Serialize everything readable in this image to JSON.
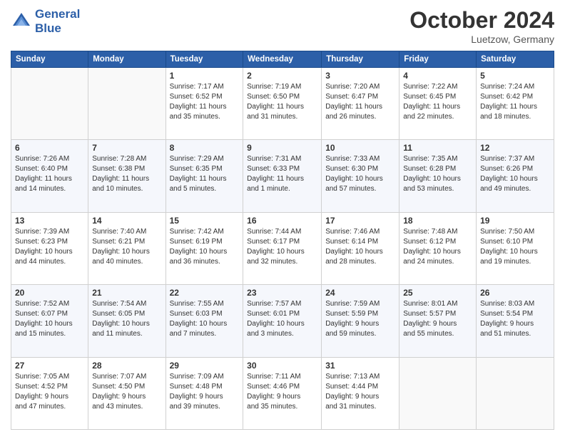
{
  "header": {
    "logo_line1": "General",
    "logo_line2": "Blue",
    "month": "October 2024",
    "location": "Luetzow, Germany"
  },
  "weekdays": [
    "Sunday",
    "Monday",
    "Tuesday",
    "Wednesday",
    "Thursday",
    "Friday",
    "Saturday"
  ],
  "rows": [
    [
      {
        "day": "",
        "info": ""
      },
      {
        "day": "",
        "info": ""
      },
      {
        "day": "1",
        "info": "Sunrise: 7:17 AM\nSunset: 6:52 PM\nDaylight: 11 hours\nand 35 minutes."
      },
      {
        "day": "2",
        "info": "Sunrise: 7:19 AM\nSunset: 6:50 PM\nDaylight: 11 hours\nand 31 minutes."
      },
      {
        "day": "3",
        "info": "Sunrise: 7:20 AM\nSunset: 6:47 PM\nDaylight: 11 hours\nand 26 minutes."
      },
      {
        "day": "4",
        "info": "Sunrise: 7:22 AM\nSunset: 6:45 PM\nDaylight: 11 hours\nand 22 minutes."
      },
      {
        "day": "5",
        "info": "Sunrise: 7:24 AM\nSunset: 6:42 PM\nDaylight: 11 hours\nand 18 minutes."
      }
    ],
    [
      {
        "day": "6",
        "info": "Sunrise: 7:26 AM\nSunset: 6:40 PM\nDaylight: 11 hours\nand 14 minutes."
      },
      {
        "day": "7",
        "info": "Sunrise: 7:28 AM\nSunset: 6:38 PM\nDaylight: 11 hours\nand 10 minutes."
      },
      {
        "day": "8",
        "info": "Sunrise: 7:29 AM\nSunset: 6:35 PM\nDaylight: 11 hours\nand 5 minutes."
      },
      {
        "day": "9",
        "info": "Sunrise: 7:31 AM\nSunset: 6:33 PM\nDaylight: 11 hours\nand 1 minute."
      },
      {
        "day": "10",
        "info": "Sunrise: 7:33 AM\nSunset: 6:30 PM\nDaylight: 10 hours\nand 57 minutes."
      },
      {
        "day": "11",
        "info": "Sunrise: 7:35 AM\nSunset: 6:28 PM\nDaylight: 10 hours\nand 53 minutes."
      },
      {
        "day": "12",
        "info": "Sunrise: 7:37 AM\nSunset: 6:26 PM\nDaylight: 10 hours\nand 49 minutes."
      }
    ],
    [
      {
        "day": "13",
        "info": "Sunrise: 7:39 AM\nSunset: 6:23 PM\nDaylight: 10 hours\nand 44 minutes."
      },
      {
        "day": "14",
        "info": "Sunrise: 7:40 AM\nSunset: 6:21 PM\nDaylight: 10 hours\nand 40 minutes."
      },
      {
        "day": "15",
        "info": "Sunrise: 7:42 AM\nSunset: 6:19 PM\nDaylight: 10 hours\nand 36 minutes."
      },
      {
        "day": "16",
        "info": "Sunrise: 7:44 AM\nSunset: 6:17 PM\nDaylight: 10 hours\nand 32 minutes."
      },
      {
        "day": "17",
        "info": "Sunrise: 7:46 AM\nSunset: 6:14 PM\nDaylight: 10 hours\nand 28 minutes."
      },
      {
        "day": "18",
        "info": "Sunrise: 7:48 AM\nSunset: 6:12 PM\nDaylight: 10 hours\nand 24 minutes."
      },
      {
        "day": "19",
        "info": "Sunrise: 7:50 AM\nSunset: 6:10 PM\nDaylight: 10 hours\nand 19 minutes."
      }
    ],
    [
      {
        "day": "20",
        "info": "Sunrise: 7:52 AM\nSunset: 6:07 PM\nDaylight: 10 hours\nand 15 minutes."
      },
      {
        "day": "21",
        "info": "Sunrise: 7:54 AM\nSunset: 6:05 PM\nDaylight: 10 hours\nand 11 minutes."
      },
      {
        "day": "22",
        "info": "Sunrise: 7:55 AM\nSunset: 6:03 PM\nDaylight: 10 hours\nand 7 minutes."
      },
      {
        "day": "23",
        "info": "Sunrise: 7:57 AM\nSunset: 6:01 PM\nDaylight: 10 hours\nand 3 minutes."
      },
      {
        "day": "24",
        "info": "Sunrise: 7:59 AM\nSunset: 5:59 PM\nDaylight: 9 hours\nand 59 minutes."
      },
      {
        "day": "25",
        "info": "Sunrise: 8:01 AM\nSunset: 5:57 PM\nDaylight: 9 hours\nand 55 minutes."
      },
      {
        "day": "26",
        "info": "Sunrise: 8:03 AM\nSunset: 5:54 PM\nDaylight: 9 hours\nand 51 minutes."
      }
    ],
    [
      {
        "day": "27",
        "info": "Sunrise: 7:05 AM\nSunset: 4:52 PM\nDaylight: 9 hours\nand 47 minutes."
      },
      {
        "day": "28",
        "info": "Sunrise: 7:07 AM\nSunset: 4:50 PM\nDaylight: 9 hours\nand 43 minutes."
      },
      {
        "day": "29",
        "info": "Sunrise: 7:09 AM\nSunset: 4:48 PM\nDaylight: 9 hours\nand 39 minutes."
      },
      {
        "day": "30",
        "info": "Sunrise: 7:11 AM\nSunset: 4:46 PM\nDaylight: 9 hours\nand 35 minutes."
      },
      {
        "day": "31",
        "info": "Sunrise: 7:13 AM\nSunset: 4:44 PM\nDaylight: 9 hours\nand 31 minutes."
      },
      {
        "day": "",
        "info": ""
      },
      {
        "day": "",
        "info": ""
      }
    ]
  ]
}
